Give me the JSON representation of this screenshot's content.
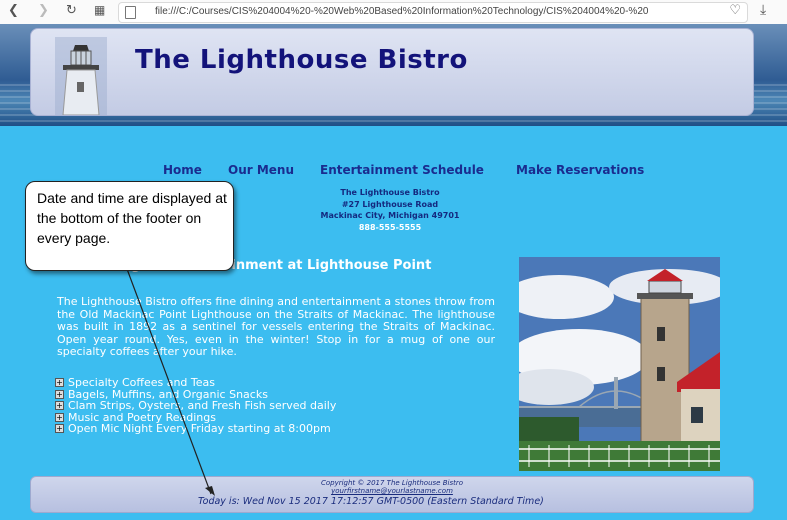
{
  "browser": {
    "url": "file:///C:/Courses/CIS%204004%20-%20Web%20Based%20Information%20Technology/CIS%204004%20-%20"
  },
  "header": {
    "title": "The Lighthouse Bistro"
  },
  "nav": {
    "home": "Home",
    "menu": "Our Menu",
    "entertainment": "Entertainment Schedule",
    "reservations": "Make Reservations"
  },
  "address": {
    "line1": "The Lighthouse Bistro",
    "line2": "#27 Lighthouse Road",
    "line3": "Mackinac City, Michigan 49701",
    "phone": "888-555-5555"
  },
  "main": {
    "heading": "Fine Dining and Entertainment at Lighthouse Point",
    "intro": "The Lighthouse Bistro offers fine dining and entertainment a stones throw from the Old Mackinac Point Lighthouse on the Straits of Mackinac. The lighthouse was built in 1892 as a sentinel for vessels entering the Straits of Mackinac. Open year round. Yes, even in the winter! Stop in for a mug of one our specialty coffees after your hike.",
    "features": [
      "Specialty Coffees and Teas",
      "Bagels, Muffins, and Organic Snacks",
      "Clam Strips, Oysters, and Fresh Fish served daily",
      "Music and Poetry Readings",
      "Open Mic Night Every Friday starting at 8:00pm"
    ]
  },
  "callout": {
    "text": "Date and time are displayed at the bottom of the footer on every page."
  },
  "footer": {
    "copyright": "Copyright © 2017 The Lighthouse Bistro",
    "email": "yourfirstname@yourlastname.com",
    "datetime": "Today is: Wed Nov 15 2017 17:12:57 GMT-0500 (Eastern Standard Time)"
  },
  "colors": {
    "page_bg": "#3cbdf0",
    "title": "#13137a",
    "nav": "#1a2c8f"
  }
}
